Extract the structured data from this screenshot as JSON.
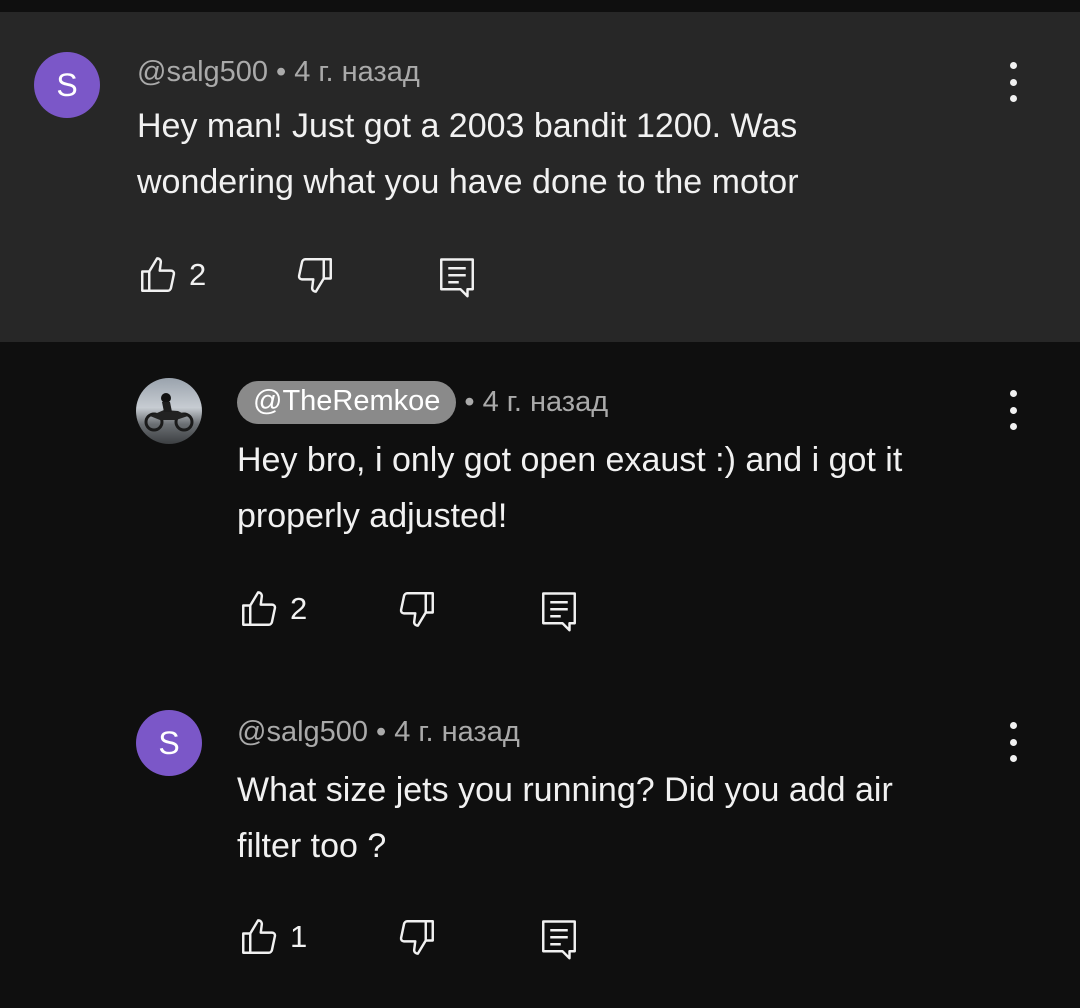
{
  "comments": [
    {
      "avatar_letter": "S",
      "author": "@salg500",
      "time": "• 4 г. назад",
      "text": "Hey man! Just got a 2003 bandit 1200. Was\nwondering what you have done to the motor",
      "likes": "2"
    },
    {
      "author": "@TheRemkoe",
      "time": "• 4 г. назад",
      "text": "Hey bro, i only got open exaust :) and i got it\nproperly adjusted!",
      "likes": "2"
    },
    {
      "avatar_letter": "S",
      "author": "@salg500",
      "time": "• 4 г. назад",
      "text": "What size jets you running? Did you add air\nfilter too ?",
      "likes": "1"
    }
  ],
  "icons": {
    "like": "thumb-up-icon",
    "dislike": "thumb-down-icon",
    "reply": "reply-comment-icon",
    "menu": "more-vert-icon"
  },
  "colors": {
    "background": "#0f0f0f",
    "highlight": "#272727",
    "avatar": "#7b57c8",
    "author_pill": "#8a8a8a",
    "text": "#f1f1f1",
    "meta": "#aaaaaa"
  }
}
